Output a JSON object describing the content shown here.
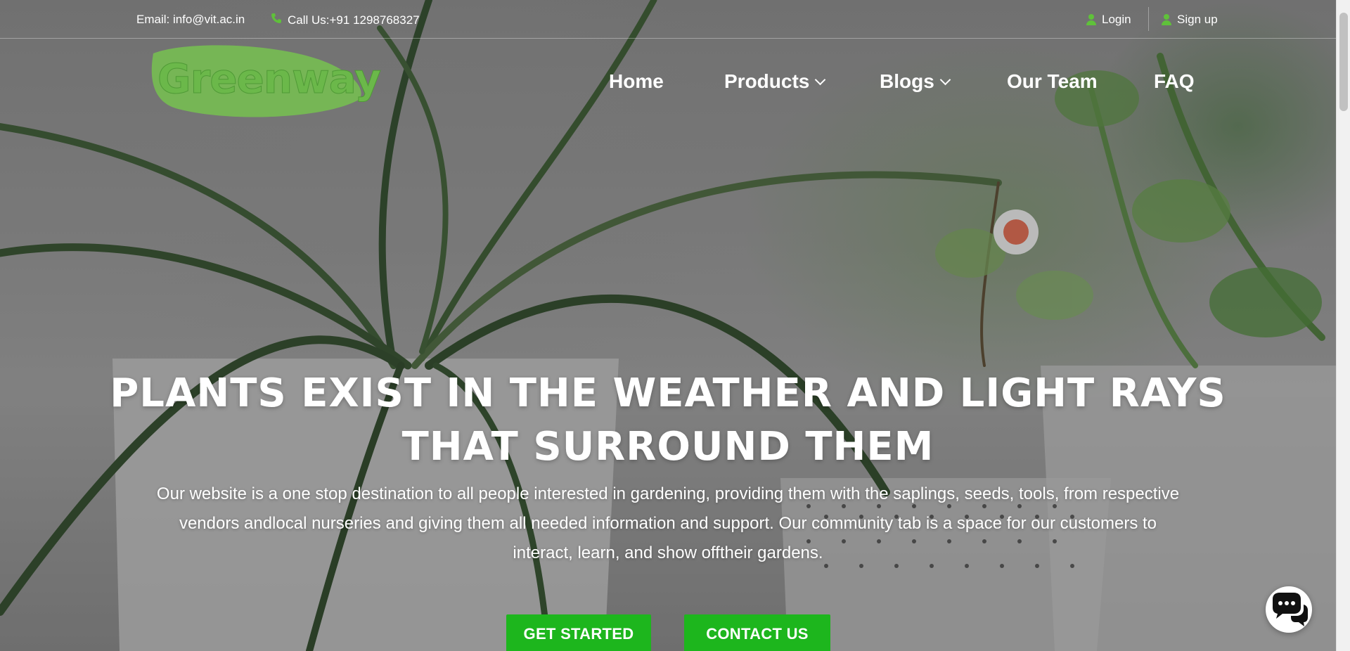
{
  "topbar": {
    "email": "Email: info@vit.ac.in",
    "phone": "Call Us:+91 1298768327",
    "login": "Login",
    "signup": "Sign up"
  },
  "brand": {
    "logo_text": "Greenway",
    "accent": "#6bb84a"
  },
  "nav": {
    "home": "Home",
    "products": "Products",
    "blogs": "Blogs",
    "team": "Our Team",
    "faq": "FAQ"
  },
  "hero": {
    "headline_line1": "PLANTS EXIST IN THE WEATHER AND LIGHT RAYS",
    "headline_line2": "THAT SURROUND THEM",
    "desc_line1": "Our website is a one stop destination to all people interested in gardening, providing them with the saplings, seeds, tools, from respective",
    "desc_line2": "vendors andlocal nurseries and giving them all needed information and support. Our community tab is a space for our customers to",
    "desc_line3": "interact, learn, and show offtheir gardens.",
    "btn_start": "GET STARTED",
    "btn_contact": "CONTACT US",
    "button_color": "#1db61d"
  },
  "icons": {
    "phone": "phone-icon",
    "user": "user-icon",
    "chevron": "chevron-down-icon",
    "chat": "chat-bubbles-icon"
  }
}
